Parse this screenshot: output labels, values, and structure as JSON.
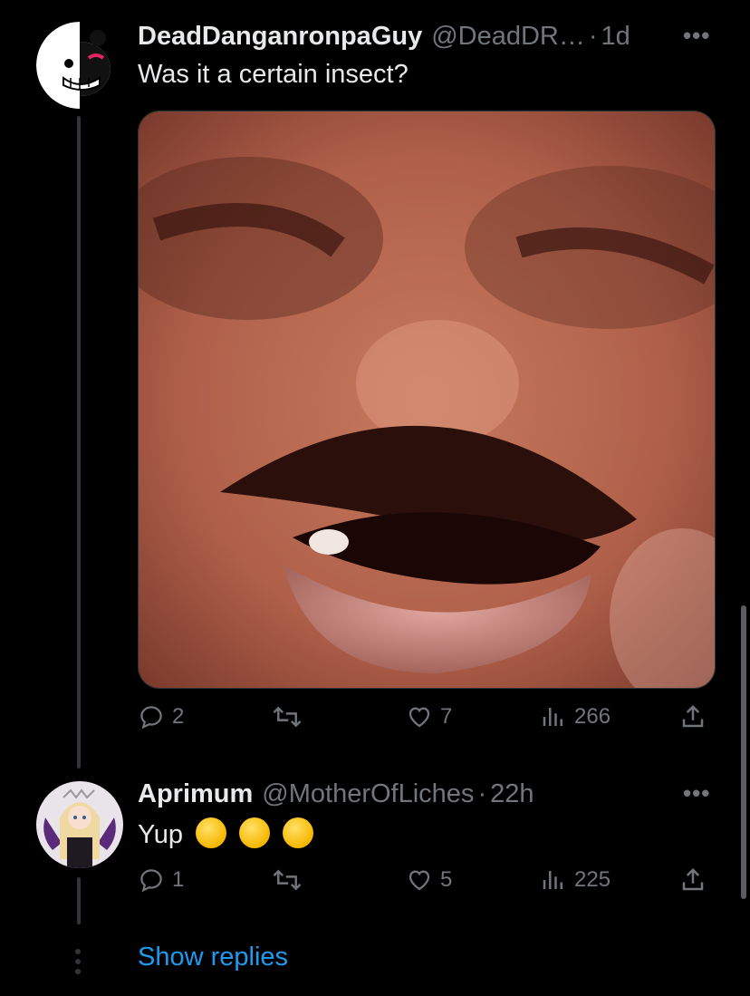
{
  "tweets": [
    {
      "name": "DeadDanganronpaGuy",
      "handle": "@DeadDR…",
      "dot": "·",
      "time": "1d",
      "text": "Was it a certain insect?",
      "avatar_icon": "monokuma-avatar",
      "stats": {
        "replies": "2",
        "likes": "7",
        "views": "266"
      }
    },
    {
      "name": "Aprimum",
      "handle": "@MotherOfLiches",
      "dot": "·",
      "time": "22h",
      "text": "Yup",
      "emoji": "rolling-on-floor-laughing x3",
      "avatar_icon": "anime-character-avatar",
      "stats": {
        "replies": "1",
        "likes": "5",
        "views": "225"
      }
    }
  ],
  "show_replies": "Show replies",
  "colors": {
    "background": "#000000",
    "text": "#e7e9ea",
    "muted": "#71767b",
    "link": "#1d9bf0",
    "line": "#333639"
  }
}
